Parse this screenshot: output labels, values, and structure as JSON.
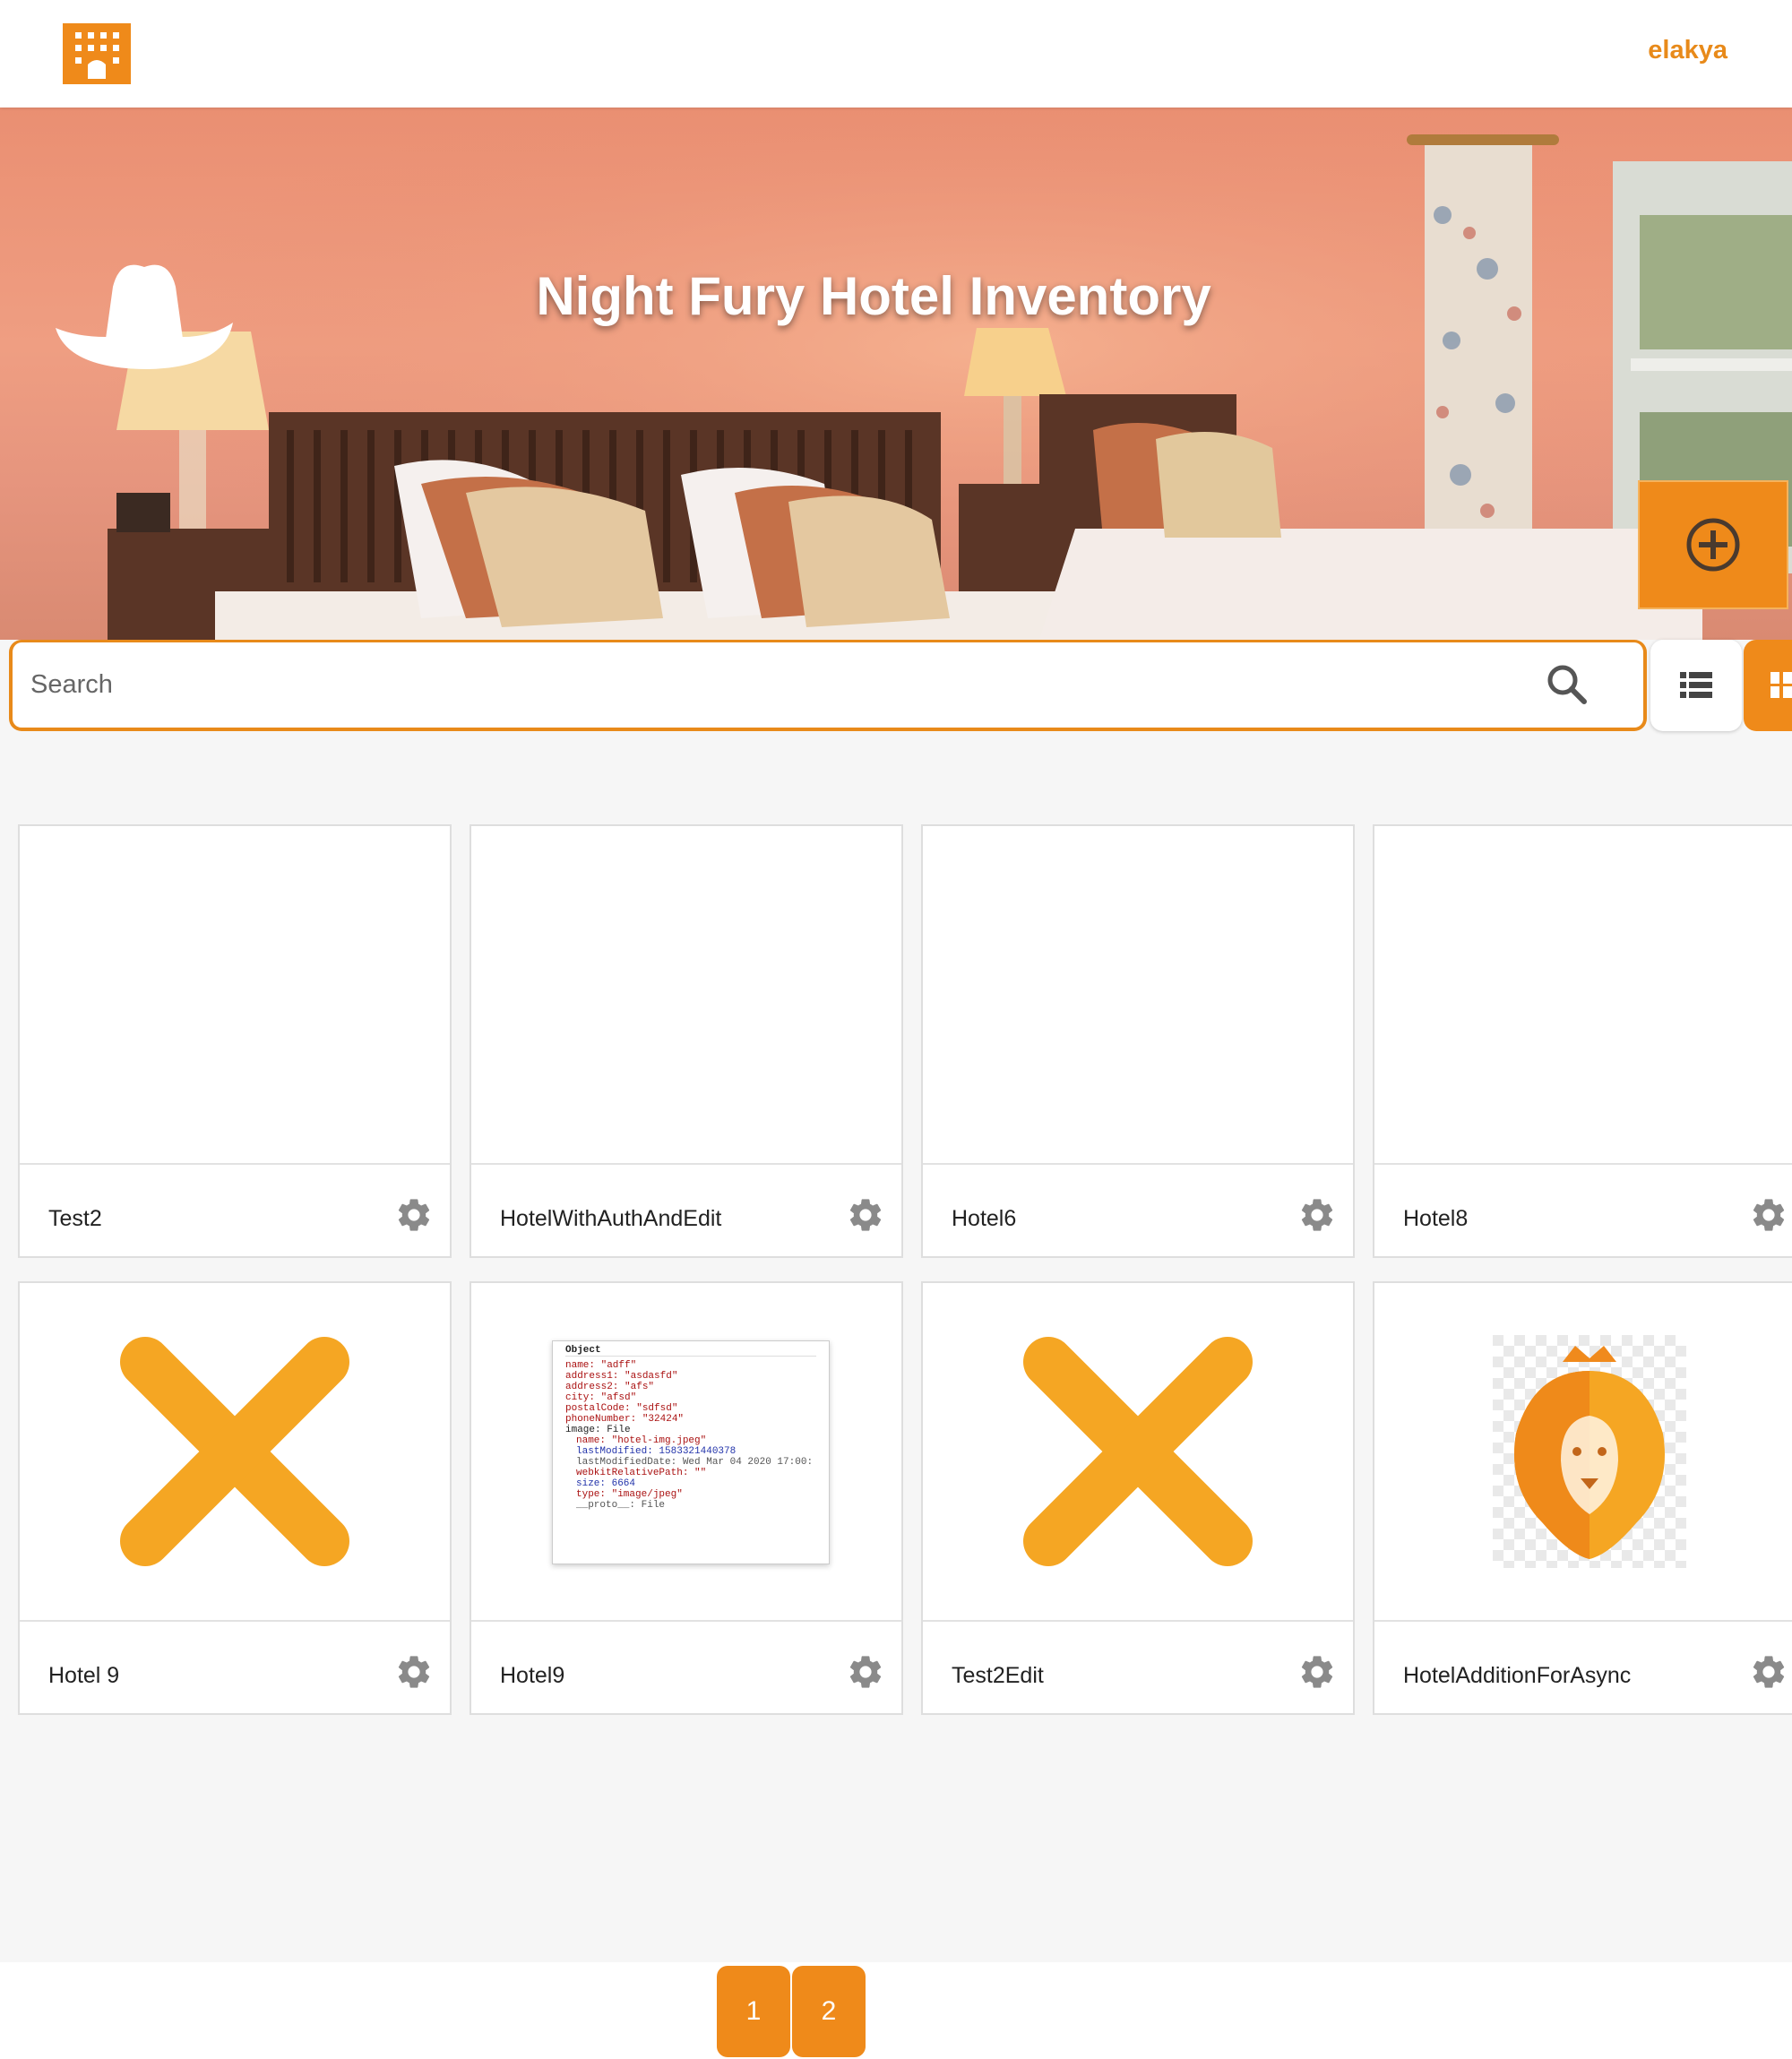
{
  "header": {
    "username": "elakya"
  },
  "hero": {
    "title": "Night Fury Hotel Inventory"
  },
  "search": {
    "placeholder": "Search"
  },
  "hotels": [
    {
      "name": "Test2",
      "image": "blank"
    },
    {
      "name": "HotelWithAuthAndEdit",
      "image": "blank"
    },
    {
      "name": "Hotel6",
      "image": "blank"
    },
    {
      "name": "Hotel8",
      "image": "blank"
    },
    {
      "name": "Hotel 9",
      "image": "orange-x"
    },
    {
      "name": "Hotel9",
      "image": "devtools-screenshot"
    },
    {
      "name": "Test2Edit",
      "image": "orange-x"
    },
    {
      "name": "HotelAdditionForAsync",
      "image": "lion-logo"
    }
  ],
  "devtools_object": {
    "title": "Object",
    "lines": [
      "name: \"adff\"",
      "address1: \"asdasfd\"",
      "address2: \"afs\"",
      "city: \"afsd\"",
      "postalCode: \"sdfsd\"",
      "phoneNumber: \"32424\"",
      "image: File",
      "name: \"hotel-img.jpeg\"",
      "lastModified: 1583321440378",
      "lastModifiedDate: Wed Mar 04 2020 17:00:",
      "webkitRelativePath: \"\"",
      "size: 6664",
      "type: \"image/jpeg\"",
      "__proto__: File"
    ]
  },
  "pagination": {
    "pages": [
      "1",
      "2"
    ]
  },
  "colors": {
    "accent": "#ef8a1a",
    "accent_text": "#e88a1a"
  },
  "icons": [
    "hotel-logo-icon",
    "cowboy-hat-icon",
    "add-circle-icon",
    "search-icon",
    "list-view-icon",
    "grid-view-icon",
    "gear-icon"
  ]
}
